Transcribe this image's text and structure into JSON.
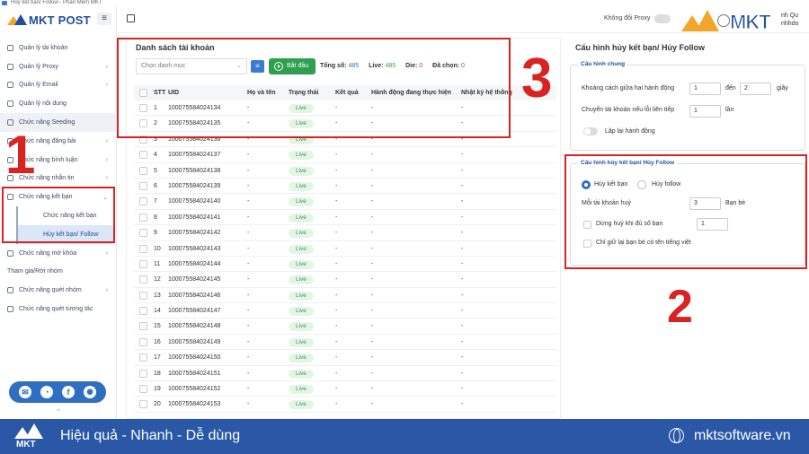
{
  "window": {
    "title": "Hủy kết bạn/ Follow - Phần Mềm MKT"
  },
  "brand": {
    "logo_text": "MKT POST",
    "badge_text": "MKT"
  },
  "sidebar": {
    "items": [
      {
        "label": "Quản lý tài khoản",
        "icon": "grid-icon"
      },
      {
        "label": "Quản lý Proxy",
        "icon": "globe-icon",
        "chevron": "›"
      },
      {
        "label": "Quản lý Email",
        "icon": "mail-icon",
        "chevron": "›"
      },
      {
        "label": "Quản lý nội dung",
        "icon": "gear-icon"
      },
      {
        "label": "Chức năng Seeding",
        "icon": "seeding-icon"
      },
      {
        "label": "Chức năng đăng bài",
        "icon": "post-icon",
        "chevron": "›"
      },
      {
        "label": "Chức năng bình luận",
        "icon": "comment-icon",
        "chevron": "›"
      },
      {
        "label": "Chức năng nhắn tin",
        "icon": "chat-icon",
        "chevron": "›"
      },
      {
        "label": "Chức năng kết bạn",
        "icon": "user-add-icon",
        "chevron": "⌄"
      }
    ],
    "sub_items": [
      "Chức năng kết bạn",
      "Hủy kết bạn/ Follow"
    ],
    "after_items": [
      {
        "label": "Chức năng mở khóa",
        "icon": "unlock-icon",
        "chevron": "›"
      }
    ],
    "plain_item": "Tham gia/Rời nhóm",
    "tail_items": [
      {
        "label": "Chức năng quét nhóm",
        "icon": "group-icon",
        "chevron": "›"
      },
      {
        "label": "Chức năng quét tương tác",
        "icon": "scan-icon"
      }
    ],
    "social": [
      "✉",
      "◔",
      "f",
      "✺"
    ],
    "collapse": "⌃"
  },
  "topbar": {
    "proxy_label": "Không đổi Proxy",
    "user": "nh Qu",
    "user2": "nhhdo"
  },
  "account_list": {
    "title": "Danh sách tài khoản",
    "category_placeholder": "Chọn danh mục",
    "start_label": "Bắt đầu",
    "total_label": "Tổng số:",
    "total": "485",
    "live_label": "Live:",
    "live": "485",
    "die_label": "Die:",
    "die": "0",
    "selected_label": "Đã chọn:",
    "selected": "0",
    "columns": [
      "STT",
      "UID",
      "Họ và tên",
      "Trạng thái",
      "Kết quả",
      "Hành động đang thực hiện",
      "Nhật ký hệ thống"
    ],
    "rows": [
      [
        "1",
        "100075584024134",
        "-",
        "Live",
        "-",
        "-",
        "-"
      ],
      [
        "2",
        "100075584024135",
        "-",
        "Live",
        "-",
        "-",
        "-"
      ],
      [
        "3",
        "100075584024136",
        "-",
        "Live",
        "-",
        "-",
        "-"
      ],
      [
        "4",
        "100075584024137",
        "-",
        "Live",
        "-",
        "-",
        "-"
      ],
      [
        "5",
        "100075584024138",
        "-",
        "Live",
        "-",
        "-",
        "-"
      ],
      [
        "6",
        "100075584024139",
        "-",
        "Live",
        "-",
        "-",
        "-"
      ],
      [
        "7",
        "100075584024140",
        "-",
        "Live",
        "-",
        "-",
        "-"
      ],
      [
        "8",
        "100075584024141",
        "-",
        "Live",
        "-",
        "-",
        "-"
      ],
      [
        "9",
        "100075584024142",
        "-",
        "Live",
        "-",
        "-",
        "-"
      ],
      [
        "10",
        "100075584024143",
        "-",
        "Live",
        "-",
        "-",
        "-"
      ],
      [
        "11",
        "100075584024144",
        "-",
        "Live",
        "-",
        "-",
        "-"
      ],
      [
        "12",
        "100075584024145",
        "-",
        "Live",
        "-",
        "-",
        "-"
      ],
      [
        "13",
        "100075584024146",
        "-",
        "Live",
        "-",
        "-",
        "-"
      ],
      [
        "14",
        "100075584024147",
        "-",
        "Live",
        "-",
        "-",
        "-"
      ],
      [
        "15",
        "100075584024148",
        "-",
        "Live",
        "-",
        "-",
        "-"
      ],
      [
        "16",
        "100075584024149",
        "-",
        "Live",
        "-",
        "-",
        "-"
      ],
      [
        "17",
        "100075584024150",
        "-",
        "Live",
        "-",
        "-",
        "-"
      ],
      [
        "18",
        "100075584024151",
        "-",
        "Live",
        "-",
        "-",
        "-"
      ],
      [
        "19",
        "100075584024152",
        "-",
        "Live",
        "-",
        "-",
        "-"
      ],
      [
        "20",
        "100075584024153",
        "-",
        "Live",
        "-",
        "-",
        "-"
      ]
    ]
  },
  "config": {
    "title": "Cấu hình hủy kết bạn/ Hủy Follow",
    "general": {
      "legend": "Cấu hình chung",
      "delay_label": "Khoảng cách giữa hai hành động",
      "delay_from": "1",
      "delay_to_label": "đến",
      "delay_to": "2",
      "delay_unit": "giây",
      "switch_label": "Chuyển tài khoản nếu lỗi liên tiếp",
      "switch_value": "1",
      "switch_unit": "lần",
      "repeat_label": "Lặp lại hành động"
    },
    "unfriend": {
      "legend": "Cấu hình hủy kết bạn/ Hủy Follow",
      "opt_unfriend": "Hủy kết bạn",
      "opt_unfollow": "Hủy follow",
      "per_account_label": "Mỗi tài khoản huỷ",
      "per_account_value": "3",
      "per_account_unit": "Bạn bè",
      "stop_label": "Dừng huỷ khi đủ số bạn",
      "stop_value": "1",
      "keep_label": "Chỉ giữ lại bạn bè có tên tiếng việt"
    }
  },
  "annotations": [
    "1",
    "2",
    "3"
  ],
  "footer": {
    "slogan": "Hiệu quả - Nhanh - Dễ dùng",
    "site": "mktsoftware.vn",
    "logo_text": "MKT"
  },
  "colors": {
    "accent": "#2f6fc2",
    "live": "#2e9e4f",
    "annotation": "#d92323",
    "footer": "#2a58a6"
  }
}
